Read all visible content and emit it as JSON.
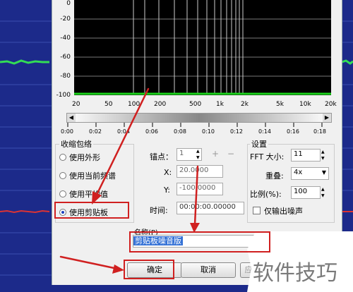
{
  "spectrum": {
    "y_ticks": [
      "0",
      "-20",
      "-40",
      "-60",
      "-80",
      "-100"
    ],
    "x_ticks": [
      "20",
      "50",
      "100",
      "200",
      "500",
      "1k",
      "2k",
      "5k",
      "10k",
      "20k"
    ]
  },
  "ruler": {
    "ticks": [
      "0:00",
      "0:02",
      "0:04",
      "0:06",
      "0:08",
      "0:10",
      "0:12",
      "0:14",
      "0:16",
      "0:18"
    ]
  },
  "envelope_group": {
    "title": "收缩包络",
    "options": [
      "使用外形",
      "使用当前频谱",
      "使用平均值",
      "使用剪贴板"
    ],
    "selected_index": 3
  },
  "anchor": {
    "label": "锚点：",
    "value": "1",
    "x_label": "X:",
    "x_value": "20.0000",
    "y_label": "Y:",
    "y_value": "-100.0000",
    "time_label": "时间:",
    "time_value": "00:00:00.00000"
  },
  "settings": {
    "title": "设置",
    "fft_label": "FFT 大小:",
    "fft_value": "11",
    "overlap_label": "重叠:",
    "overlap_value": "4x",
    "ratio_label": "比例(%):",
    "ratio_value": "100",
    "output_noise_label": "仅输出噪声"
  },
  "name_field": {
    "label": "名称(P)",
    "value": "剪贴板噪音版"
  },
  "buttons": {
    "ok": "确定",
    "cancel": "取消",
    "apply_partial": "应"
  },
  "watermark": "软件技巧",
  "colors": {
    "annotation_red": "#d02020",
    "waveform_bg": "#1c2a8a",
    "spectrum_bg": "#000000"
  }
}
